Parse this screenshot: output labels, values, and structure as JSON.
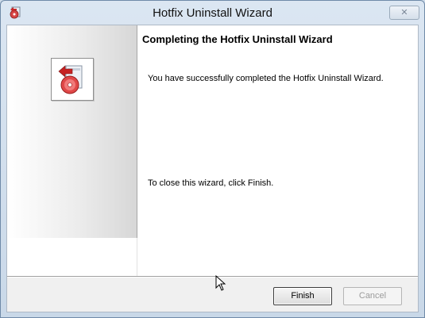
{
  "window": {
    "title": "Hotfix Uninstall Wizard",
    "close_glyph": "✕",
    "app_icon": "hotfix-uninstall-icon"
  },
  "wizard": {
    "heading": "Completing the Hotfix Uninstall Wizard",
    "message": "You have successfully completed the Hotfix Uninstall Wizard.",
    "close_instruction": "To close this wizard, click Finish.",
    "panel_icon": "uninstall-disc-icon"
  },
  "buttons": {
    "finish": "Finish",
    "cancel": "Cancel",
    "cancel_enabled": false
  },
  "colors": {
    "title_bar": "#dbe6f2",
    "accent_icon": "#cc2a2a"
  }
}
